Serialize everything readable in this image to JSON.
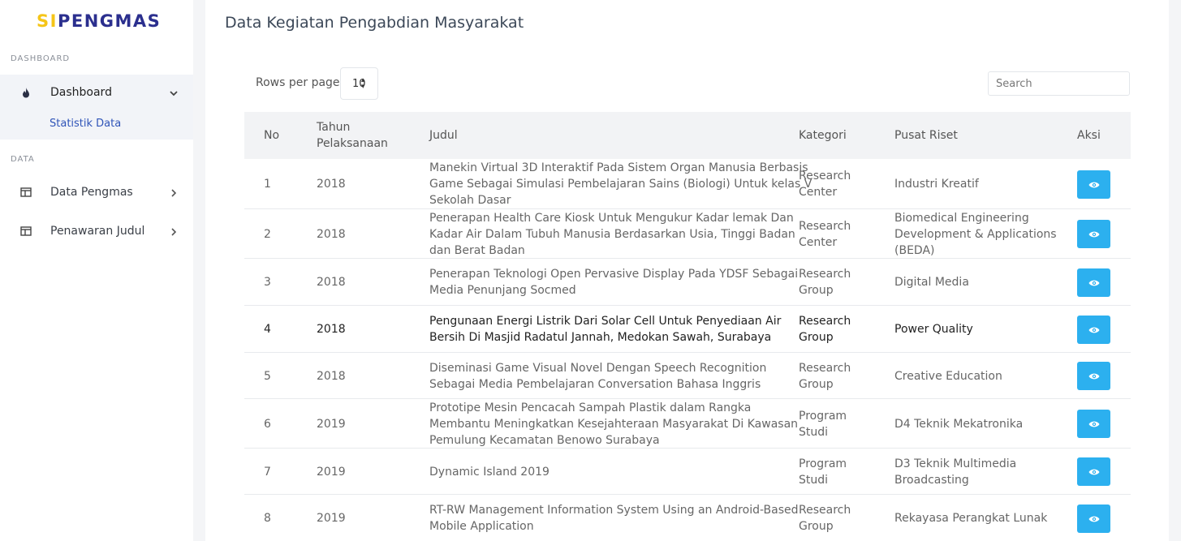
{
  "brand": {
    "part1": "SI",
    "part2": "PENGMAS"
  },
  "sidebar": {
    "section_dashboard": "DASHBOARD",
    "section_data": "DATA",
    "items": [
      {
        "label": "Dashboard",
        "icon": "flame-icon"
      },
      {
        "label": "Data Pengmas",
        "icon": "table-icon"
      },
      {
        "label": "Penawaran Judul",
        "icon": "table-icon"
      }
    ],
    "subitem": "Statistik Data"
  },
  "page": {
    "title": "Data Kegiatan Pengabdian Masyarakat"
  },
  "controls": {
    "rows_per_page_label": "Rows per page:",
    "rows_per_page_value": "10",
    "search_placeholder": "Search"
  },
  "table": {
    "headers": {
      "no": "No",
      "tahun": [
        "Tahun",
        "Pelaksanaan"
      ],
      "judul": "Judul",
      "kategori": "Kategori",
      "pusat": "Pusat Riset",
      "aksi": "Aksi"
    },
    "rows": [
      {
        "no": "1",
        "tahun": "2018",
        "judul": [
          "Manekin Virtual 3D Interaktif Pada Sistem Organ Manusia Berbasis",
          "Game Sebagai Simulasi Pembelajaran Sains (Biologi) Untuk kelas V",
          "Sekolah Dasar"
        ],
        "kategori": [
          "Research",
          "Center"
        ],
        "pusat": [
          "Industri Kreatif"
        ]
      },
      {
        "no": "2",
        "tahun": "2018",
        "judul": [
          "Penerapan Health Care Kiosk Untuk Mengukur Kadar lemak Dan",
          "Kadar Air Dalam Tubuh Manusia Berdasarkan Usia, Tinggi Badan",
          "dan Berat Badan"
        ],
        "kategori": [
          "Research",
          "Center"
        ],
        "pusat": [
          "Biomedical Engineering",
          "Development & Applications",
          "(BEDA)"
        ]
      },
      {
        "no": "3",
        "tahun": "2018",
        "judul": [
          "Penerapan Teknologi Open Pervasive Display Pada YDSF Sebagai",
          "Media Penunjang Socmed"
        ],
        "kategori": [
          "Research",
          "Group"
        ],
        "pusat": [
          "Digital Media"
        ]
      },
      {
        "no": "4",
        "tahun": "2018",
        "judul": [
          "Pengunaan Energi Listrik Dari Solar Cell Untuk Penyediaan Air",
          "Bersih Di Masjid Radatul Jannah, Medokan Sawah, Surabaya"
        ],
        "kategori": [
          "Research",
          "Group"
        ],
        "pusat": [
          "Power Quality"
        ]
      },
      {
        "no": "5",
        "tahun": "2018",
        "judul": [
          "Diseminasi Game Visual Novel Dengan Speech Recognition",
          "Sebagai Media Pembelajaran Conversation Bahasa Inggris"
        ],
        "kategori": [
          "Research",
          "Group"
        ],
        "pusat": [
          "Creative Education"
        ]
      },
      {
        "no": "6",
        "tahun": "2019",
        "judul": [
          "Prototipe Mesin Pencacah Sampah Plastik dalam Rangka",
          "Membantu Meningkatkan Kesejahteraan Masyarakat Di Kawasan",
          "Pemulung Kecamatan Benowo Surabaya"
        ],
        "kategori": [
          "Program",
          "Studi"
        ],
        "pusat": [
          "D4 Teknik Mekatronika"
        ]
      },
      {
        "no": "7",
        "tahun": "2019",
        "judul": [
          "Dynamic Island 2019"
        ],
        "kategori": [
          "Program",
          "Studi"
        ],
        "pusat": [
          "D3 Teknik Multimedia",
          "Broadcasting"
        ]
      },
      {
        "no": "8",
        "tahun": "2019",
        "judul": [
          "RT-RW Management Information System Using an Android-Based",
          "Mobile Application"
        ],
        "kategori": [
          "Research",
          "Group"
        ],
        "pusat": [
          "Rekayasa Perangkat Lunak"
        ]
      }
    ]
  },
  "colors": {
    "brand_blue": "#2b2f8e",
    "brand_yellow": "#f5c518",
    "action_blue": "#2cb0ef",
    "active_link": "#2f54b8"
  }
}
